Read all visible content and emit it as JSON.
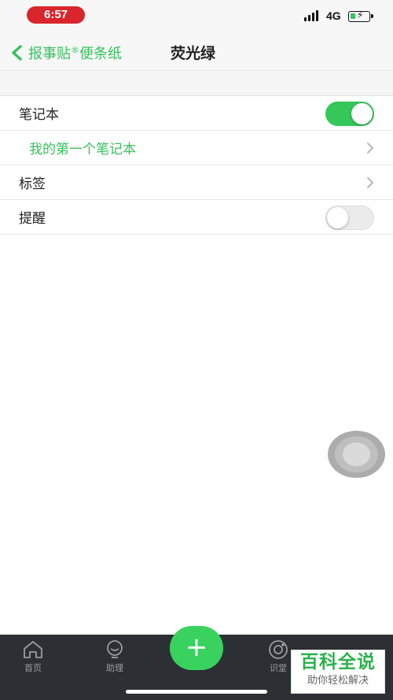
{
  "status_bar": {
    "time": "6:57",
    "network": "4G"
  },
  "nav": {
    "back_label": "报事贴",
    "back_label_suffix": "便条纸",
    "registered_mark": "®",
    "title": "荧光绿"
  },
  "settings": {
    "notebook": {
      "label": "笔记本",
      "toggle_on": true
    },
    "selected_notebook": "我的第一个笔记本",
    "tags": {
      "label": "标签"
    },
    "reminder": {
      "label": "提醒",
      "toggle_on": false
    }
  },
  "tab_bar": {
    "tabs": [
      {
        "label": "首页",
        "icon": "home-icon"
      },
      {
        "label": "助理",
        "icon": "assistant-icon"
      },
      {
        "label": "识堂",
        "icon": "learn-icon"
      }
    ],
    "add_label": "+"
  },
  "watermark": {
    "title": "百科全说",
    "subtitle": "助你轻松解决"
  },
  "colors": {
    "accent": "#37c25d",
    "toggle_on": "#35c759",
    "tab_bar_bg": "#2c2f33"
  }
}
